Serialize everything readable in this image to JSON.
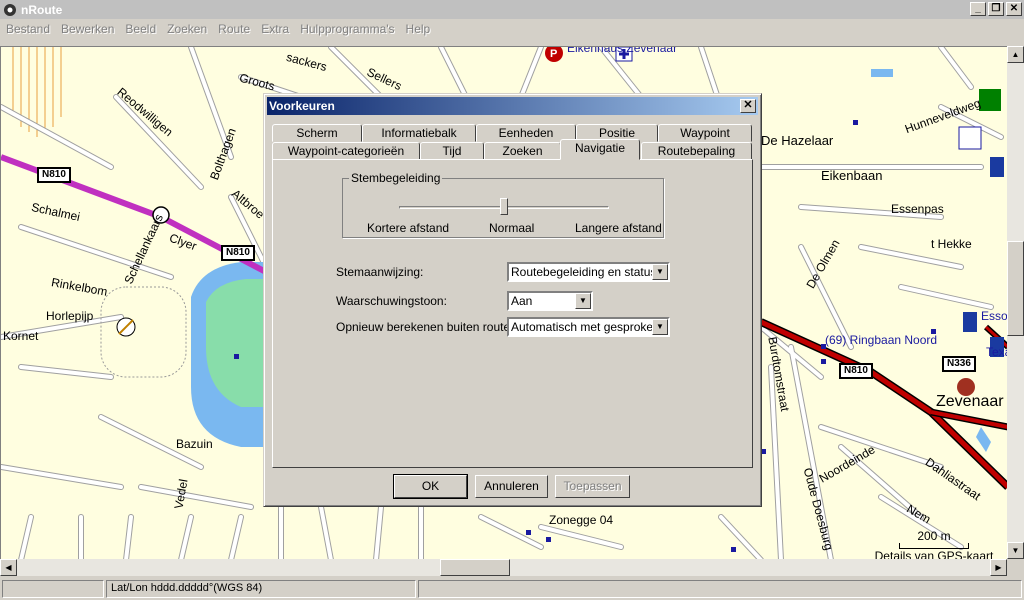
{
  "window": {
    "title": "nRoute"
  },
  "menu": [
    "Bestand",
    "Bewerken",
    "Beeld",
    "Zoeken",
    "Route",
    "Extra",
    "Hulpprogramma's",
    "Help"
  ],
  "map": {
    "labels": [
      {
        "text": "Reodwilligen"
      },
      {
        "text": "Bolthagen"
      },
      {
        "text": "Groots"
      },
      {
        "text": "sackers"
      },
      {
        "text": "Sellers"
      },
      {
        "text": "Schalmei"
      },
      {
        "text": "Schellankaars"
      },
      {
        "text": "Clyer"
      },
      {
        "text": "Altbroe"
      },
      {
        "text": "Rinkelbom"
      },
      {
        "text": "Horlepijp"
      },
      {
        "text": "Kornet"
      },
      {
        "text": "Bazuin"
      },
      {
        "text": "Eikenbaan"
      },
      {
        "text": "De Hazelaar"
      },
      {
        "text": "Hunneveldweg"
      },
      {
        "text": "Essenpas"
      },
      {
        "text": "t Hekke"
      },
      {
        "text": "De Olmen"
      },
      {
        "text": "(69) Ringbaan Noord"
      },
      {
        "text": "Zevenaar"
      },
      {
        "text": "Noordeinde"
      },
      {
        "text": "Dahliastraat"
      },
      {
        "text": "Oude Doesburg"
      },
      {
        "text": "Zonegge 04"
      },
      {
        "text": "Burdtomstraat"
      },
      {
        "text": "Esso"
      },
      {
        "text": "Texa"
      },
      {
        "text": "Eikenhaus Zevenaar"
      },
      {
        "text": "Vedel"
      },
      {
        "text": "Nem"
      }
    ],
    "shields": [
      "N810",
      "N810",
      "N810",
      "N336"
    ],
    "scale": "200 m",
    "detail_label": "Details van GPS-kaart"
  },
  "dialog": {
    "title": "Voorkeuren",
    "tabs_row1": [
      "Scherm",
      "Informatiebalk",
      "Eenheden",
      "Positie",
      "Waypoint"
    ],
    "tabs_row2": [
      "Waypoint-categorieën",
      "Tijd",
      "Zoeken",
      "Navigatie",
      "Routebepaling"
    ],
    "active_tab": "Navigatie",
    "group": {
      "title": "Stembegeleiding",
      "slider_min": "Kortere afstand",
      "slider_mid": "Normaal",
      "slider_max": "Langere afstand",
      "slider_value": 0.5
    },
    "fields": [
      {
        "label": "Stemaanwijzing:",
        "value": "Routebegeleiding en status"
      },
      {
        "label": "Waarschuwingstoon:",
        "value": "Aan"
      },
      {
        "label": "Opnieuw berekenen buiten route:",
        "value": "Automatisch met gesproken al"
      }
    ],
    "buttons": {
      "ok": "OK",
      "cancel": "Annuleren",
      "apply": "Toepassen"
    }
  },
  "status": {
    "latlon": "Lat/Lon hddd.ddddd°(WGS 84)"
  }
}
